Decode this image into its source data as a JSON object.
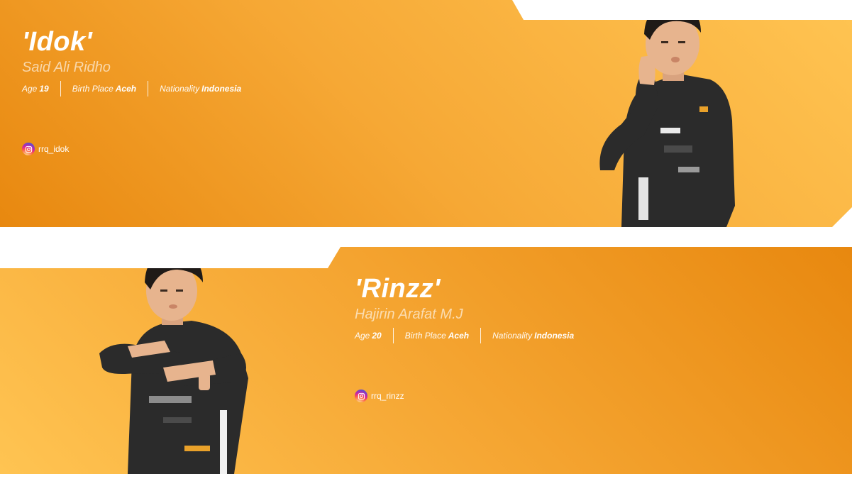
{
  "players": [
    {
      "nickname": "'Idok'",
      "real_name": "Said Ali Ridho",
      "age_label": "Age",
      "age": "19",
      "birth_place_label": "Birth Place",
      "birth_place": "Aceh",
      "nationality_label": "Nationality",
      "nationality": "Indonesia",
      "instagram": "rrq_idok"
    },
    {
      "nickname": "'Rinzz'",
      "real_name": "Hajirin Arafat M.J",
      "age_label": "Age",
      "age": "20",
      "birth_place_label": "Birth Place",
      "birth_place": "Aceh",
      "nationality_label": "Nationality",
      "nationality": "Indonesia",
      "instagram": "rrq_rinzz"
    }
  ],
  "colors": {
    "card_dark": "#e8880f",
    "card_light": "#ffc452",
    "jersey": "#2b2b2b",
    "skin": "#e7b48e",
    "hair": "#1f1a17"
  },
  "icons": {
    "social": "instagram-icon"
  }
}
